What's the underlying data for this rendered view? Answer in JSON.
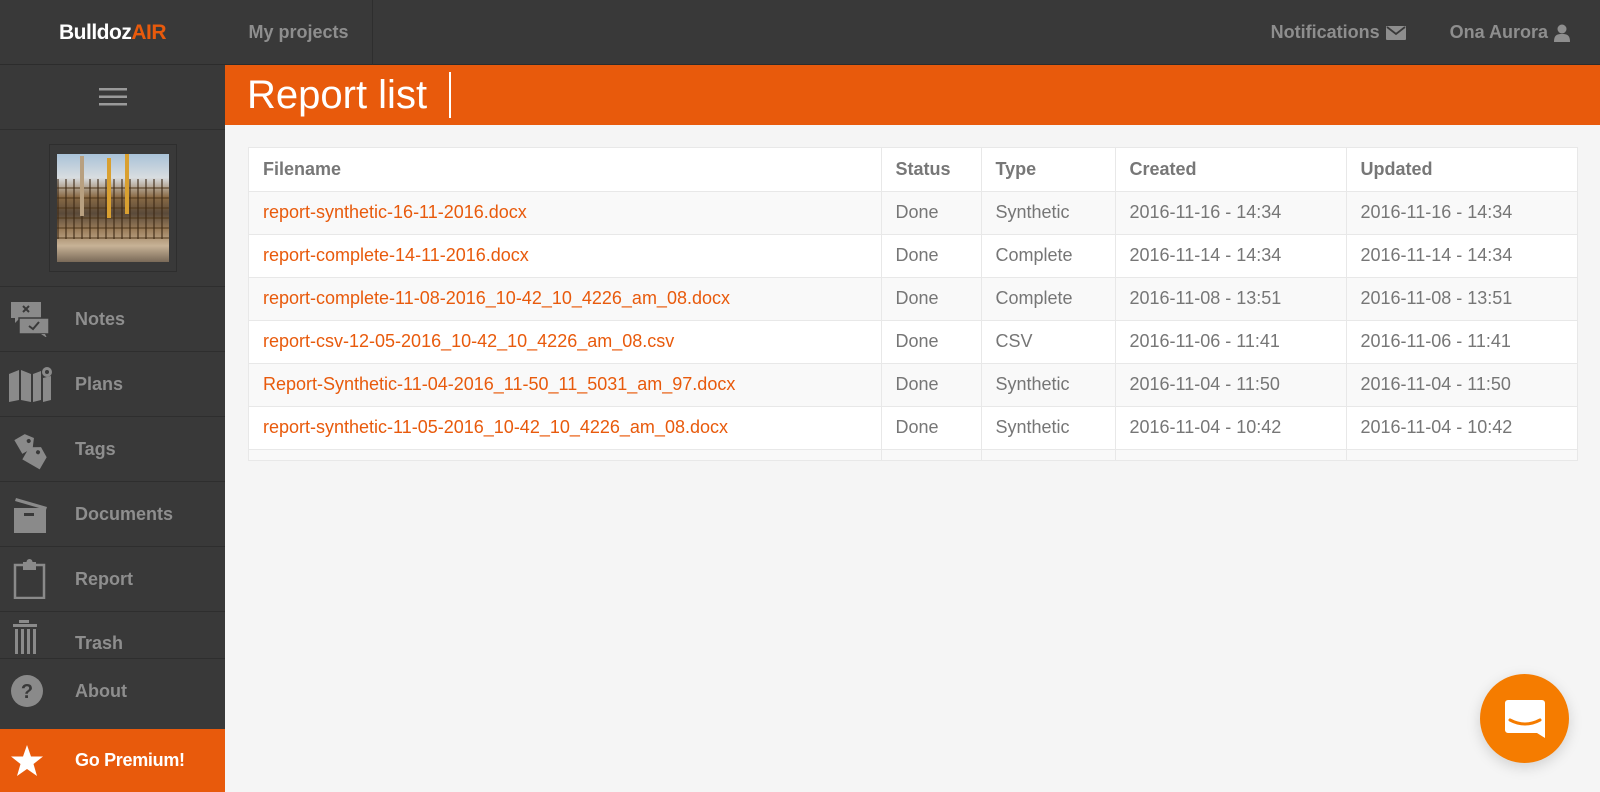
{
  "brand": {
    "part1": "Bulldoz",
    "part2": "AIR"
  },
  "topnav": {
    "projects_label": "My projects",
    "notifications_label": "Notifications",
    "notifications_icon": "envelope-icon",
    "user_label": "Ona Aurora",
    "user_icon": "user-icon"
  },
  "sidebar": {
    "menu_icon": "hamburger-icon",
    "project_image_alt": "construction site project thumbnail",
    "items": [
      {
        "label": "Notes",
        "icon": "notes-icon"
      },
      {
        "label": "Plans",
        "icon": "map-pin-icon"
      },
      {
        "label": "Tags",
        "icon": "tags-icon"
      },
      {
        "label": "Documents",
        "icon": "box-icon"
      },
      {
        "label": "Report",
        "icon": "clipboard-icon"
      },
      {
        "label": "Trash",
        "icon": "trash-icon"
      },
      {
        "label": "About",
        "icon": "question-icon"
      }
    ],
    "premium_label": "Go Premium!",
    "premium_icon": "star-icon"
  },
  "page": {
    "title": "Report list"
  },
  "table": {
    "columns": [
      "Filename",
      "Status",
      "Type",
      "Created",
      "Updated"
    ],
    "rows": [
      {
        "filename": "report-synthetic-16-11-2016.docx",
        "status": "Done",
        "type": "Synthetic",
        "created": "2016-11-16 - 14:34",
        "updated": "2016-11-16 - 14:34"
      },
      {
        "filename": "report-complete-14-11-2016.docx",
        "status": "Done",
        "type": "Complete",
        "created": "2016-11-14 - 14:34",
        "updated": "2016-11-14 - 14:34"
      },
      {
        "filename": "report-complete-11-08-2016_10-42_10_4226_am_08.docx",
        "status": "Done",
        "type": "Complete",
        "created": "2016-11-08 - 13:51",
        "updated": "2016-11-08 - 13:51"
      },
      {
        "filename": "report-csv-12-05-2016_10-42_10_4226_am_08.csv",
        "status": "Done",
        "type": "CSV",
        "created": "2016-11-06 - 11:41",
        "updated": "2016-11-06 - 11:41"
      },
      {
        "filename": "Report-Synthetic-11-04-2016_11-50_11_5031_am_97.docx",
        "status": "Done",
        "type": "Synthetic",
        "created": "2016-11-04 - 11:50",
        "updated": "2016-11-04 - 11:50"
      },
      {
        "filename": "report-synthetic-11-05-2016_10-42_10_4226_am_08.docx",
        "status": "Done",
        "type": "Synthetic",
        "created": "2016-11-04 - 10:42",
        "updated": "2016-11-04 - 10:42"
      }
    ]
  },
  "chat": {
    "icon": "chat-icon"
  },
  "colors": {
    "accent": "#e85a0c",
    "nav_bg": "#393939",
    "nav_text": "#8e8e8e",
    "chat": "#f57c00"
  }
}
